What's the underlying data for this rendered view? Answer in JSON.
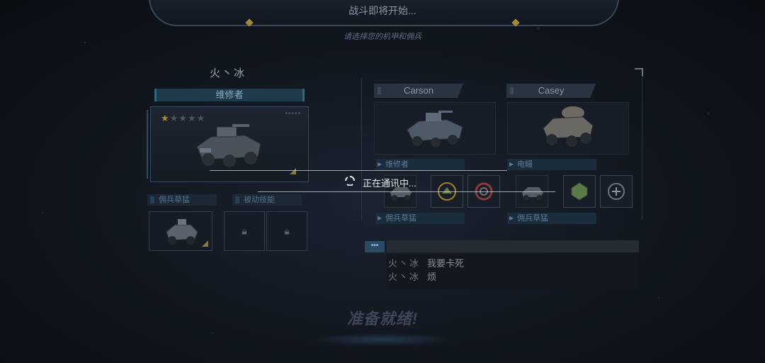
{
  "header": {
    "title": "战斗即将开始...",
    "subtitle": "请选择您的机甲和佣兵"
  },
  "player": {
    "name": "火丶冰",
    "role": "维修者",
    "stars_filled": 1,
    "stars_total": 5,
    "slot_labels": [
      "佣兵草猛",
      "被动技能"
    ]
  },
  "mercenaries": [
    {
      "name": "Carson",
      "role": "维修者",
      "sub_label": "佣兵草猛"
    },
    {
      "name": "Casey",
      "role": "电鳗",
      "sub_label": "佣兵草猛"
    }
  ],
  "chat": {
    "tab_label": "•••",
    "messages": [
      {
        "sender": "火丶冰",
        "text": "我要卡死"
      },
      {
        "sender": "火丶冰",
        "text": "烦"
      }
    ]
  },
  "ready_text": "准备就绪!",
  "loading": {
    "text": "正在通讯中..."
  },
  "colors": {
    "star_gold": "#b08a2a",
    "accent_teal": "#2d6a80",
    "marker": "#8a7a2a"
  }
}
